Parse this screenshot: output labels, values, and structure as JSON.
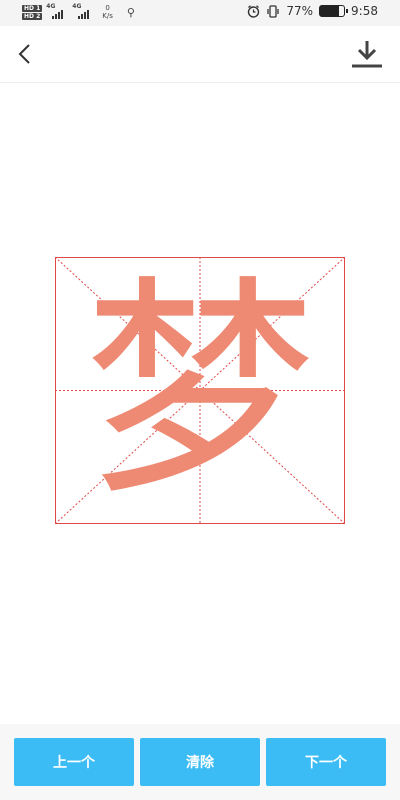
{
  "status_bar": {
    "sim1": "HD 1",
    "sim2": "HD 2",
    "net1": "4G",
    "net2": "4G",
    "speed_value": "0",
    "speed_unit": "K/s",
    "battery_percent": "77%",
    "battery_level": 0.77,
    "time": "9:58",
    "icons": [
      "usb-icon",
      "alarm-icon",
      "vibrate-icon",
      "battery-icon"
    ]
  },
  "header": {
    "back_icon": "chevron-left-icon",
    "download_icon": "download-icon"
  },
  "character": {
    "glyph": "梦",
    "color": "#ee8a73",
    "grid_color": "#e04848"
  },
  "buttons": {
    "prev": "上一个",
    "clear": "清除",
    "next": "下一个",
    "color": "#3cbcf4"
  }
}
